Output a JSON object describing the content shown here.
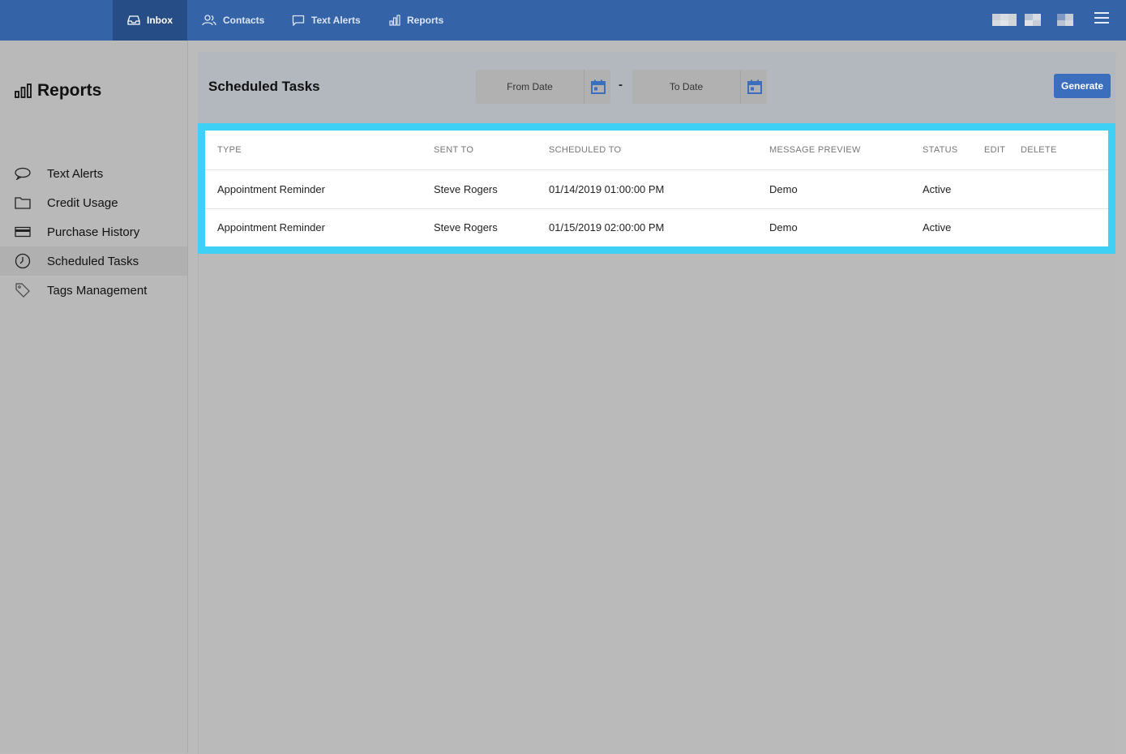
{
  "nav": {
    "items": [
      {
        "label": "Inbox",
        "icon": "inbox-icon",
        "active": true
      },
      {
        "label": "Contacts",
        "icon": "contacts-icon"
      },
      {
        "label": "Text Alerts",
        "icon": "chat-bubble-icon"
      },
      {
        "label": "Reports",
        "icon": "bar-chart-icon"
      }
    ]
  },
  "sidebar": {
    "title": "Reports",
    "items": [
      {
        "label": "Text Alerts",
        "icon": "chat-bubble-icon"
      },
      {
        "label": "Credit Usage",
        "icon": "folder-icon"
      },
      {
        "label": "Purchase History",
        "icon": "credit-card-icon"
      },
      {
        "label": "Scheduled Tasks",
        "icon": "clock-icon",
        "active": true
      },
      {
        "label": "Tags Management",
        "icon": "tag-icon"
      }
    ]
  },
  "main": {
    "title": "Scheduled Tasks",
    "from_date_placeholder": "From Date",
    "to_date_placeholder": "To Date",
    "date_separator": "-",
    "generate_label": "Generate"
  },
  "table": {
    "columns": [
      "TYPE",
      "SENT TO",
      "SCHEDULED TO",
      "MESSAGE PREVIEW",
      "STATUS",
      "EDIT",
      "DELETE"
    ],
    "rows": [
      [
        "Appointment Reminder",
        "Steve Rogers",
        "01/14/2019 01:00:00 PM",
        "Demo",
        "Active",
        "",
        ""
      ],
      [
        "Appointment Reminder",
        "Steve Rogers",
        "01/15/2019 02:00:00 PM",
        "Demo",
        "Active",
        "",
        ""
      ]
    ]
  },
  "colors": {
    "topbar": "#3464a7",
    "highlight": "#3fd0f5",
    "accent_button": "#3b6fbd"
  }
}
